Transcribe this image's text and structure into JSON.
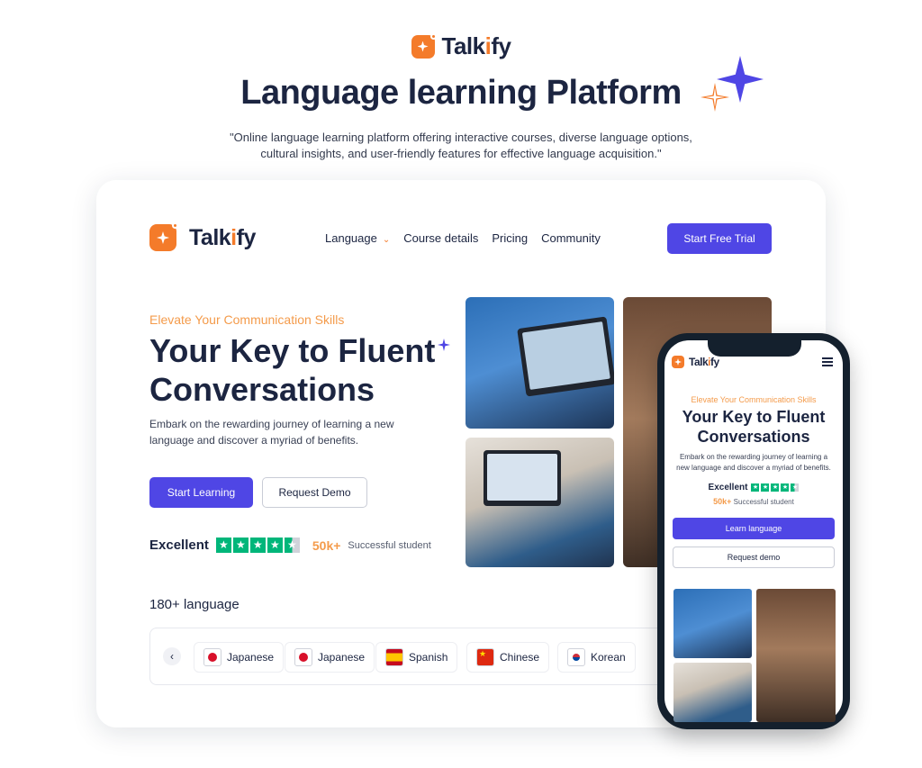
{
  "brand": {
    "name_pre": "Talk",
    "name_i": "i",
    "name_post": "fy",
    "accent": "#f47b2a"
  },
  "header": {
    "title": "Language learning Platform",
    "subtitle": "\"Online language learning platform offering interactive courses, diverse language options, cultural insights, and user-friendly features for effective language acquisition.\""
  },
  "nav": {
    "items": [
      {
        "label": "Language"
      },
      {
        "label": "Course details"
      },
      {
        "label": "Pricing"
      },
      {
        "label": "Community"
      }
    ],
    "cta_label": "Start Free Trial"
  },
  "hero": {
    "eyebrow": "Elevate Your Communication Skills",
    "title": "Your Key to Fluent Conversations",
    "description": "Embark on the rewarding journey of learning a new language and discover a myriad of benefits.",
    "primary_label": "Start Learning",
    "secondary_label": "Request Demo"
  },
  "rating": {
    "label": "Excellent",
    "stars": 4.5,
    "count": "50k+",
    "count_label": "Successful student"
  },
  "languages": {
    "title": "180+ language",
    "prev_icon": "chevron-left-icon",
    "items": [
      {
        "label": "Japanese",
        "flag": "japan-flag-icon"
      },
      {
        "label": "Japanese",
        "flag": "japan-flag-icon"
      },
      {
        "label": "Spanish",
        "flag": "spain-flag-icon"
      },
      {
        "label": "Chinese",
        "flag": "china-flag-icon"
      },
      {
        "label": "Korean",
        "flag": "korea-flag-icon"
      }
    ]
  },
  "mobile": {
    "eyebrow": "Elevate Your Communication Skills",
    "title": "Your Key to Fluent Conversations",
    "description": "Embark on the rewarding journey of learning a new language and discover a myriad of benefits.",
    "rating_label": "Excellent",
    "count": "50k+",
    "count_label": "Successful student",
    "primary_label": "Learn language",
    "secondary_label": "Request demo",
    "menu_icon": "hamburger-menu-icon"
  },
  "colors": {
    "primary": "#4f46e5",
    "accent": "#f47b2a",
    "text": "#1c2541",
    "star": "#00b67a"
  }
}
